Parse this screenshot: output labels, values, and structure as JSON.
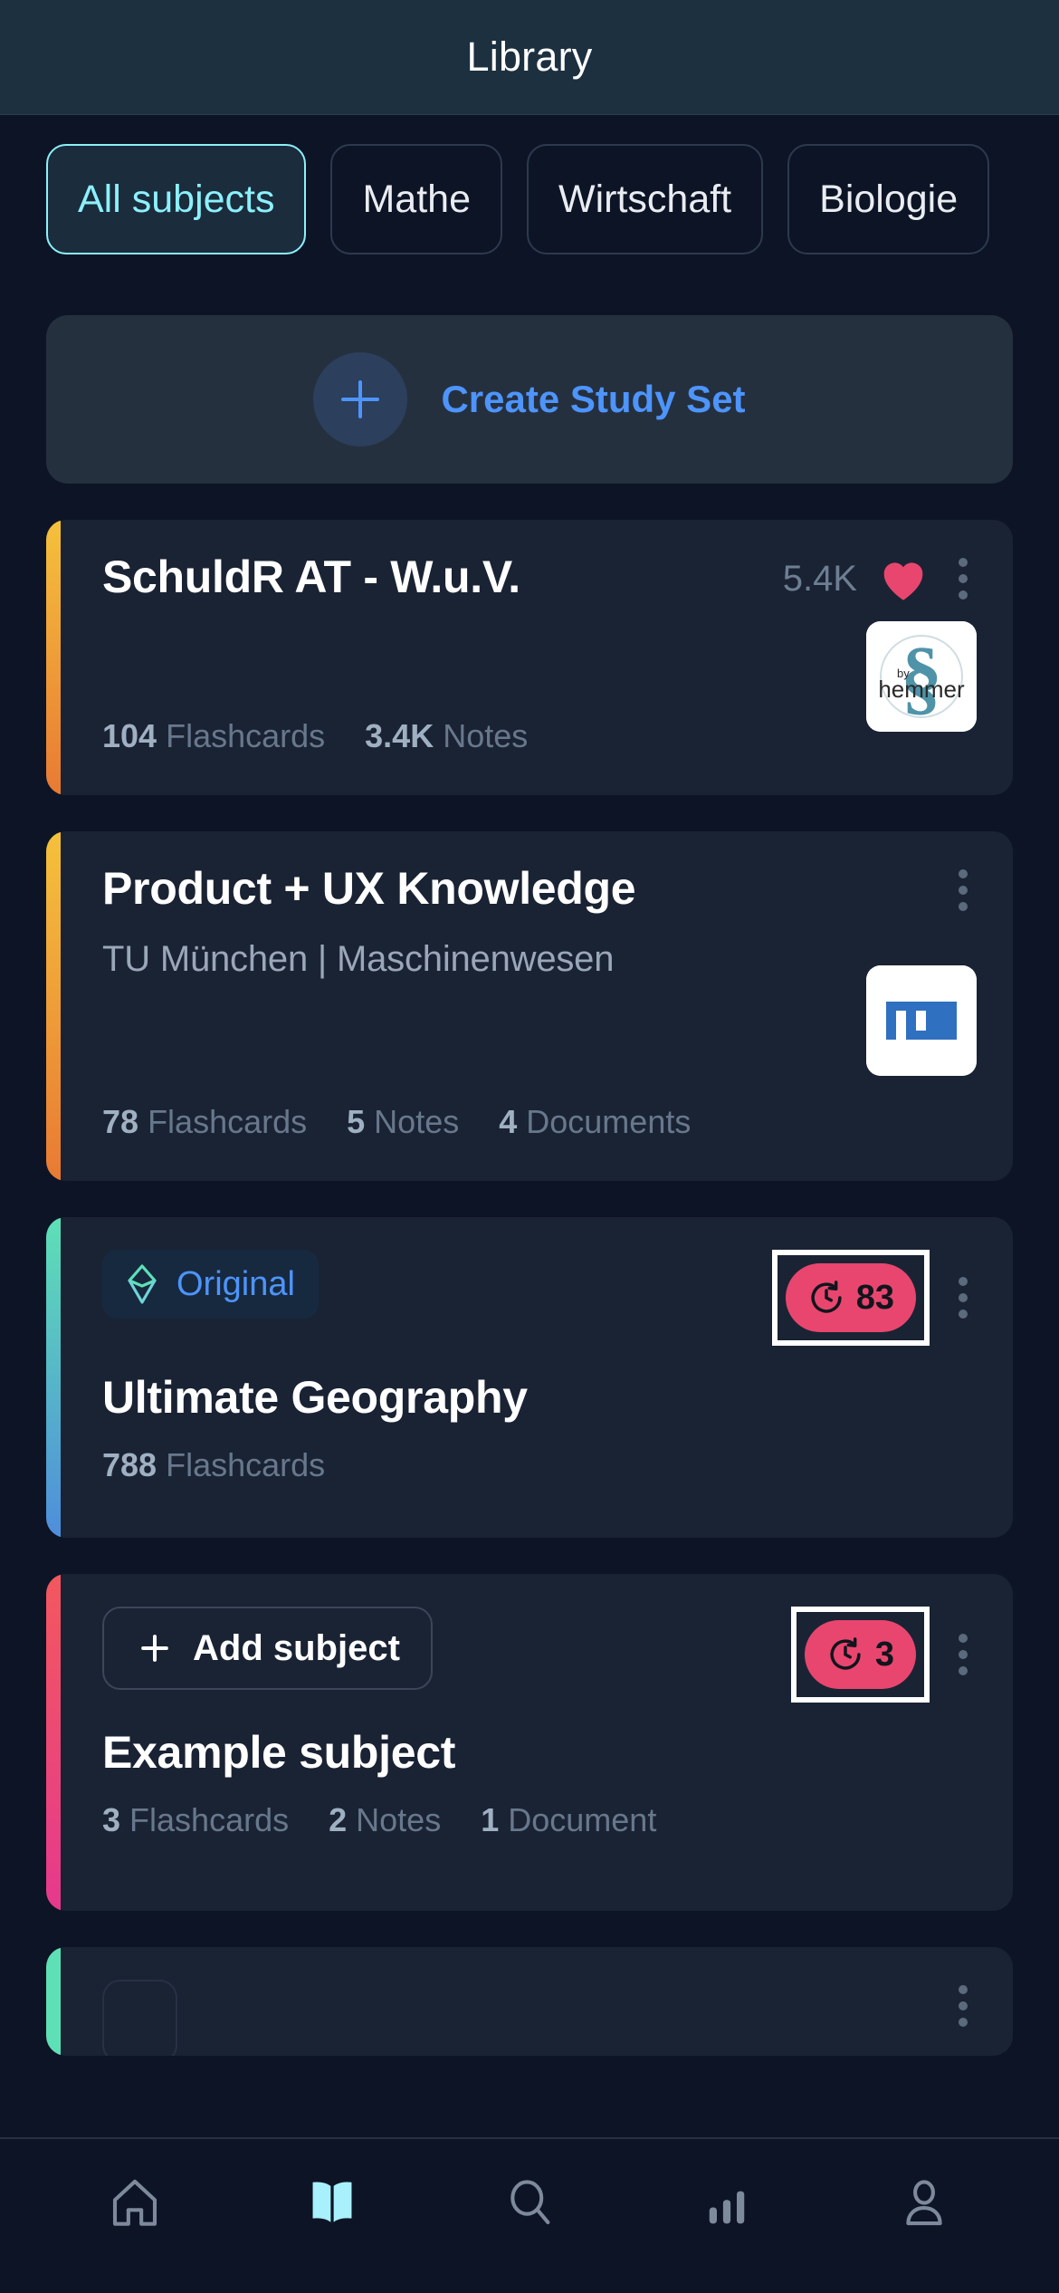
{
  "header": {
    "title": "Library"
  },
  "filters": {
    "chips": [
      {
        "label": "All subjects",
        "active": true
      },
      {
        "label": "Mathe",
        "active": false
      },
      {
        "label": "Wirtschaft",
        "active": false
      },
      {
        "label": "Biologie",
        "active": false
      }
    ]
  },
  "create": {
    "label": "Create Study Set",
    "icon": "plus-icon"
  },
  "colors": {
    "accent_cyan": "#8cf0fb",
    "accent_blue": "#4d94fb",
    "heart_pink": "#e8466e",
    "timer_pink": "#e8466e",
    "card_bg": "#1a2334",
    "page_bg": "#0d1425",
    "header_bg": "#1c3040"
  },
  "cards": [
    {
      "title": "SchuldR AT - W.u.V.",
      "subtitle": "",
      "likes": "5.4K",
      "logo": "hemmer-logo",
      "logo_text": "hemmer",
      "logo_sub": "by",
      "stats": [
        {
          "num": "104",
          "label": "Flashcards"
        },
        {
          "num": "3.4K",
          "label": "Notes"
        }
      ]
    },
    {
      "title": "Product + UX Knowledge",
      "subtitle": "TU München | Maschinenwesen",
      "logo": "tum-logo",
      "logo_text": "TUM",
      "stats": [
        {
          "num": "78",
          "label": "Flashcards"
        },
        {
          "num": "5",
          "label": "Notes"
        },
        {
          "num": "4",
          "label": "Documents"
        }
      ]
    },
    {
      "title": "Ultimate Geography",
      "badge": "Original",
      "timer": "83",
      "stats": [
        {
          "num": "788",
          "label": "Flashcards"
        }
      ]
    },
    {
      "title": "Example subject",
      "add_subject": "Add subject",
      "timer": "3",
      "stats": [
        {
          "num": "3",
          "label": "Flashcards"
        },
        {
          "num": "2",
          "label": "Notes"
        },
        {
          "num": "1",
          "label": "Document"
        }
      ]
    }
  ],
  "bottom_nav": {
    "items": [
      {
        "icon": "home-icon",
        "active": false
      },
      {
        "icon": "book-icon",
        "active": true
      },
      {
        "icon": "search-icon",
        "active": false
      },
      {
        "icon": "stats-bars-icon",
        "active": false
      },
      {
        "icon": "profile-icon",
        "active": false
      }
    ]
  }
}
